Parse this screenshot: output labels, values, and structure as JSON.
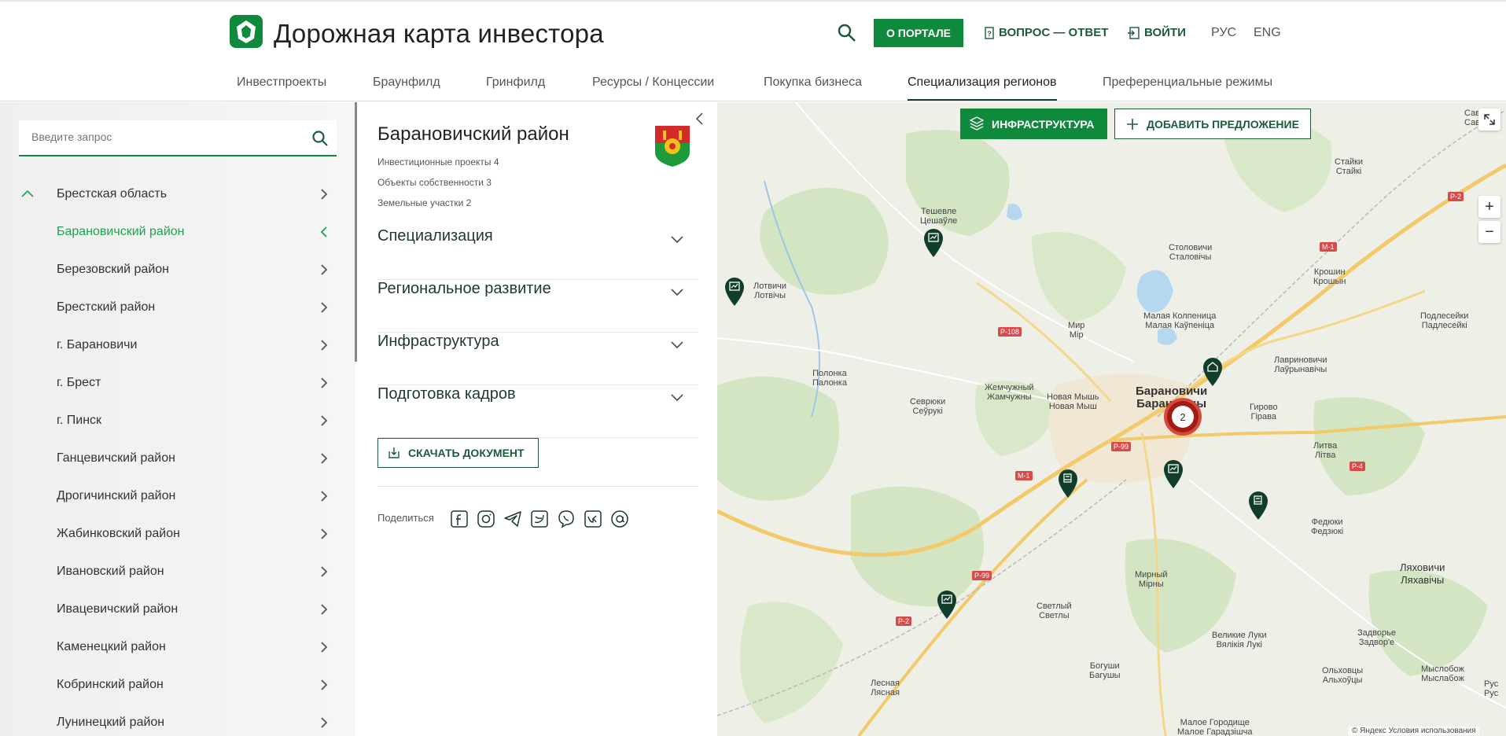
{
  "header": {
    "brand_title": "Дорожная карта инвестора",
    "portal_label": "О ПОРТАЛЕ",
    "faq_label": "ВОПРОС — ОТВЕТ",
    "login_label": "ВОЙТИ",
    "lang_ru": "РУС",
    "lang_en": "ENG",
    "brand_color": "#0f8a3c"
  },
  "nav": [
    {
      "label": "Инвестпроекты"
    },
    {
      "label": "Браунфилд"
    },
    {
      "label": "Гринфилд"
    },
    {
      "label": "Ресурсы / Концессии"
    },
    {
      "label": "Покупка бизнеса"
    },
    {
      "label": "Специализация регионов",
      "active": true
    },
    {
      "label": "Преференциальные режимы"
    }
  ],
  "sidebar": {
    "search_placeholder": "Введите запрос",
    "items": [
      {
        "label": "Брестская область",
        "expanded": true
      },
      {
        "label": "Барановичский район",
        "active": true
      },
      {
        "label": "Березовский район"
      },
      {
        "label": "Брестский район"
      },
      {
        "label": "г. Барановичи"
      },
      {
        "label": "г. Брест"
      },
      {
        "label": "г. Пинск"
      },
      {
        "label": "Ганцевичский район"
      },
      {
        "label": "Дрогичинский район"
      },
      {
        "label": "Жабинковский район"
      },
      {
        "label": "Ивановский район"
      },
      {
        "label": "Ивацевичский район"
      },
      {
        "label": "Каменецкий район"
      },
      {
        "label": "Кобринский район"
      },
      {
        "label": "Лунинецкий район"
      }
    ]
  },
  "panel": {
    "title": "Барановичский район",
    "meta": [
      "Инвестиционные проекты 4",
      "Объекты собственности 3",
      "Земельные участки 2"
    ],
    "accordions": [
      "Специализация",
      "Региональное развитие",
      "Инфраструктура",
      "Подготовка кадров"
    ],
    "download_label": "СКАЧАТЬ ДОКУМЕНТ",
    "share_label": "Поделиться"
  },
  "map": {
    "infra_label": "ИНФРАСТРУКТУРА",
    "add_label": "ДОБАВИТЬ ПРЕДЛОЖЕНИЕ",
    "zoom_in": "+",
    "zoom_out": "−",
    "cluster_count": "2",
    "copyright": "© Яндекс Условия использования",
    "places": [
      {
        "name": "Тешевле",
        "alt": "Цешаўле"
      },
      {
        "name": "Лотвичи",
        "alt": "Лотвічы"
      },
      {
        "name": "Полонка",
        "alt": "Палонка"
      },
      {
        "name": "Севрюки",
        "alt": "Сеўрукі"
      },
      {
        "name": "Жемчужный",
        "alt": "Жамчужны"
      },
      {
        "name": "Новая Мышь",
        "alt": "Новая Мыш"
      },
      {
        "name": "Мир",
        "alt": "Мір"
      },
      {
        "name": "Столовичи",
        "alt": "Сталовічы"
      },
      {
        "name": "Малая Колпеница",
        "alt": "Малая Каўпеніца"
      },
      {
        "name": "Барановичи",
        "alt": "Баранавічы"
      },
      {
        "name": "Крошин",
        "alt": "Крошын"
      },
      {
        "name": "Лавриновичи",
        "alt": "Лаўрынавічы"
      },
      {
        "name": "Гирово",
        "alt": "Гірава"
      },
      {
        "name": "Подлесейки",
        "alt": "Падлесейкі"
      },
      {
        "name": "Литва",
        "alt": "Літва"
      },
      {
        "name": "Федюки",
        "alt": "Федзюкі"
      },
      {
        "name": "Ляховичи",
        "alt": "Ляхавічы"
      },
      {
        "name": "Мирный",
        "alt": "Мірны"
      },
      {
        "name": "Светлый",
        "alt": "Светлы"
      },
      {
        "name": "Великие Луки",
        "alt": "Вялікія Лукі"
      },
      {
        "name": "Богуши",
        "alt": "Багушы"
      },
      {
        "name": "Лесная",
        "alt": "Лясная"
      },
      {
        "name": "Задворье",
        "alt": "Задвор'е"
      },
      {
        "name": "Ольховцы",
        "alt": "Альхоўцы"
      },
      {
        "name": "Мыслобож",
        "alt": "Мыслабож"
      },
      {
        "name": "Малое Городище",
        "alt": "Малое Гарадзішча"
      },
      {
        "name": "Стайки",
        "alt": "Стайкі"
      },
      {
        "name": "Сав",
        "alt": "Сав"
      },
      {
        "name": "Рус",
        "alt": "Рус"
      }
    ],
    "roads": [
      "Р-108",
      "Р-99",
      "М-1",
      "Р-2",
      "Р-4",
      "Р-99",
      "Р-2",
      "М-1"
    ]
  }
}
